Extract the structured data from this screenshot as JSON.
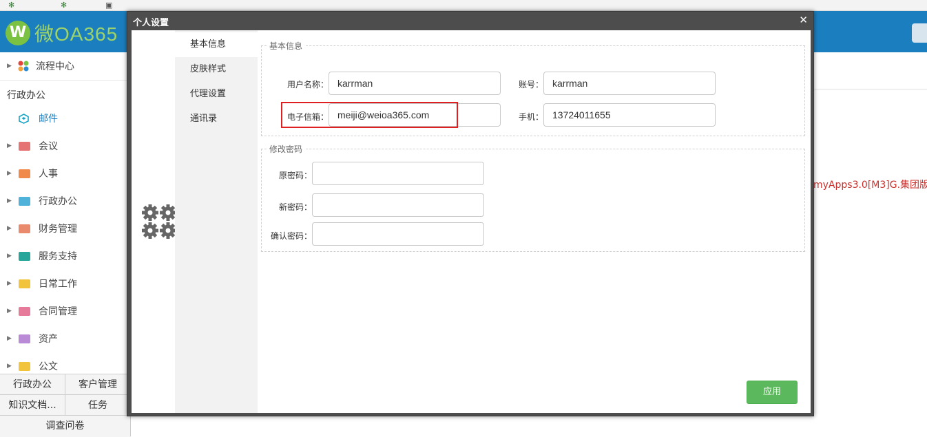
{
  "header": {
    "logo_letter": "W",
    "logo_text": "微OA365"
  },
  "sidebar": {
    "process_center": "流程中心",
    "group_title": "行政办公",
    "active_item": "邮件",
    "items": [
      {
        "label": "会议",
        "color": "#e57373"
      },
      {
        "label": "人事",
        "color": "#ef8a4a"
      },
      {
        "label": "行政办公",
        "color": "#4fb3d9"
      },
      {
        "label": "财务管理",
        "color": "#e98a6c"
      },
      {
        "label": "服务支持",
        "color": "#26a69a"
      },
      {
        "label": "日常工作",
        "color": "#f2c33d"
      },
      {
        "label": "合同管理",
        "color": "#e57a9a"
      },
      {
        "label": "资产",
        "color": "#b98ad6"
      },
      {
        "label": "公文",
        "color": "#f2c33d"
      }
    ]
  },
  "bottom_tabs": {
    "tab1": "行政办公",
    "tab2": "客户管理",
    "tab3": "知识文档...",
    "tab4": "任务",
    "tab5": "调查问卷"
  },
  "right_panel": {
    "app_version_text": "myApps3.0[M3]G.集团版"
  },
  "modal": {
    "title": "个人设置",
    "close_symbol": "✕",
    "nav": [
      "基本信息",
      "皮肤样式",
      "代理设置",
      "通讯录"
    ],
    "basic_info": {
      "legend": "基本信息",
      "username_label": "用户名称：",
      "username_value": "karrman",
      "account_label": "账号：",
      "account_value": "karrman",
      "email_label": "电子信箱：",
      "email_value": "meiji@weioa365.com",
      "phone_label": "手机：",
      "phone_value": "13724011655"
    },
    "password": {
      "legend": "修改密码",
      "old_label": "原密码：",
      "new_label": "新密码：",
      "confirm_label": "确认密码："
    },
    "apply_label": "应用"
  },
  "colors": {
    "header_blue": "#1b7fbf",
    "apply_green": "#5cb85c",
    "highlight_red": "#e02020"
  }
}
